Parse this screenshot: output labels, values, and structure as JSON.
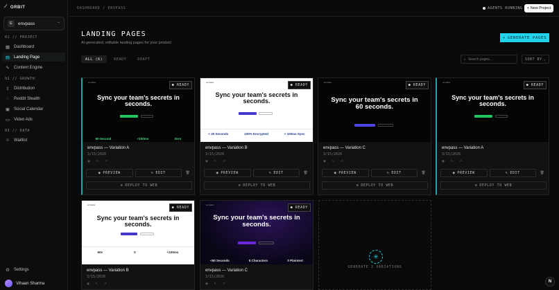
{
  "app": {
    "logo": "ORBIT",
    "project": "envpass",
    "project_badge": "E"
  },
  "sidebar": {
    "sections": [
      {
        "label": "01 // PROJECT",
        "items": [
          {
            "label": "Dashboard",
            "icon": "grid-icon"
          },
          {
            "label": "Landing Page",
            "icon": "layout-icon",
            "active": true
          },
          {
            "label": "Content Engine",
            "icon": "pen-icon"
          }
        ]
      },
      {
        "label": "02 // GROWTH",
        "items": [
          {
            "label": "Distribution",
            "icon": "share-icon"
          },
          {
            "label": "Reddit Stealth",
            "icon": "chat-icon"
          },
          {
            "label": "Social Calendar",
            "icon": "calendar-icon"
          },
          {
            "label": "Video Ads",
            "icon": "video-icon"
          }
        ]
      },
      {
        "label": "03 // DATA",
        "items": [
          {
            "label": "Waitlist",
            "icon": "users-icon"
          }
        ]
      }
    ],
    "settings": "Settings",
    "user": "Vihaan Sharma"
  },
  "topbar": {
    "breadcrumb": "DASHBOARD / ENVPASS",
    "agents": "AGENTS RUNNING",
    "new_project": "New Project"
  },
  "page": {
    "title": "LANDING PAGES",
    "subtitle": "AI-generated, editable landing pages for your product",
    "generate": "GENERATE PAGES"
  },
  "filters": {
    "tabs": [
      "ALL (6)",
      "READY",
      "DRAFT"
    ],
    "search_placeholder": "Search pages...",
    "sort": "SORT BY"
  },
  "cards": [
    {
      "name": "envpass — Variation A",
      "date": "3/15/2026",
      "status": "READY",
      "headline": "Sync your team's secrets in seconds.",
      "stats": [
        "60-Second",
        "<100ms",
        "Zero"
      ],
      "theme": "dark"
    },
    {
      "name": "envpass — Variation B",
      "date": "3/15/2026",
      "status": "READY",
      "headline": "Sync your team's secrets in seconds.",
      "stats": [
        "< 30 Seconds",
        "100% Encrypted",
        "< 100ms Sync"
      ],
      "theme": "light"
    },
    {
      "name": "envpass — Variation C",
      "date": "3/15/2026",
      "status": "READY",
      "headline": "Sync your team's secrets in 60 seconds.",
      "stats": [],
      "theme": "dark"
    },
    {
      "name": "envpass — Variation A",
      "date": "3/15/2026",
      "status": "READY",
      "headline": "Sync your team's secrets in seconds.",
      "stats": [],
      "theme": "dark"
    },
    {
      "name": "envpass — Variation B",
      "date": "3/15/2026",
      "status": "READY",
      "headline": "Sync your team's secrets in seconds.",
      "stats": [
        "60s",
        "0",
        "<100ms"
      ],
      "theme": "light"
    },
    {
      "name": "envpass — Variation C",
      "date": "3/15/2026",
      "status": "READY",
      "headline": "Sync your team's secrets in seconds.",
      "stats": [
        "<60 Seconds",
        "8 Characters",
        "0 Plaintext"
      ],
      "theme": "purple"
    }
  ],
  "card_actions": {
    "preview": "PREVIEW",
    "edit": "EDIT",
    "deploy": "DEPLOY TO WEB",
    "mini_brand": "envpass"
  },
  "generate_card": "GENERATE 3 VARIATIONS",
  "colors": {
    "accent": "#22d3ee",
    "bg": "#0a0a0a"
  }
}
